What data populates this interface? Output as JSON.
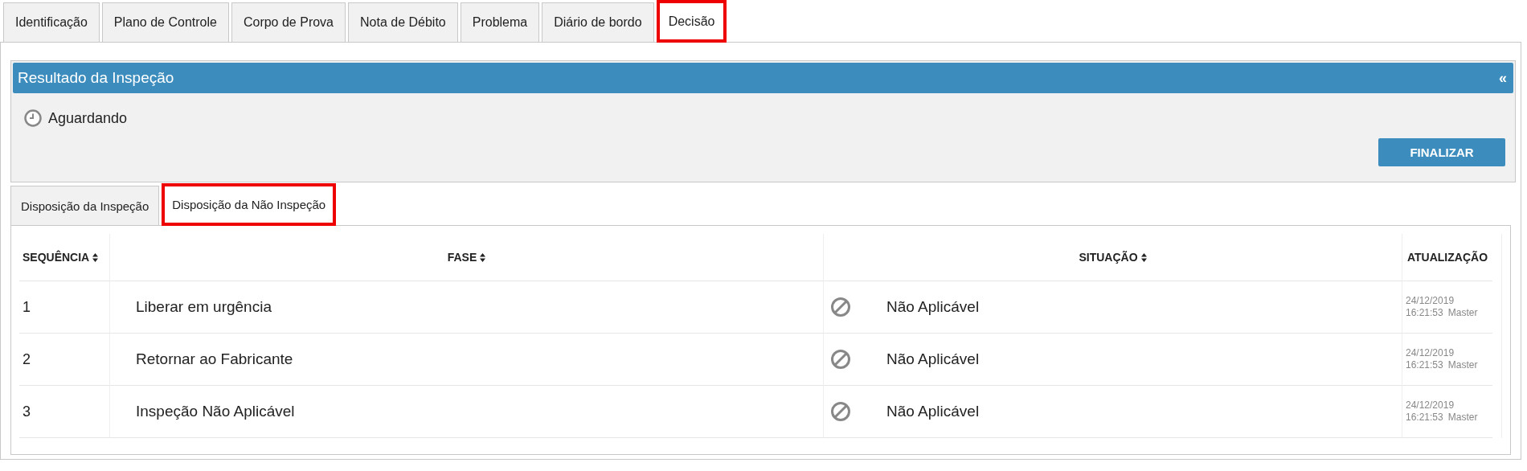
{
  "tabs": [
    {
      "label": "Identificação",
      "selected": false,
      "highlighted": false
    },
    {
      "label": "Plano de Controle",
      "selected": false,
      "highlighted": false
    },
    {
      "label": "Corpo de Prova",
      "selected": false,
      "highlighted": false
    },
    {
      "label": "Nota de Débito",
      "selected": false,
      "highlighted": false
    },
    {
      "label": "Problema",
      "selected": false,
      "highlighted": false
    },
    {
      "label": "Diário de bordo",
      "selected": false,
      "highlighted": false
    },
    {
      "label": "Decisão",
      "selected": true,
      "highlighted": true
    }
  ],
  "result_panel": {
    "title": "Resultado da Inspeção",
    "collapse": "«",
    "status": "Aguardando",
    "button": "FINALIZAR"
  },
  "sub_tabs": [
    {
      "label": "Disposição da Inspeção",
      "selected": false,
      "highlighted": false
    },
    {
      "label": "Disposição da Não Inspeção",
      "selected": true,
      "highlighted": true
    }
  ],
  "table": {
    "columns": [
      {
        "label": "SEQUÊNCIA",
        "sortable": true
      },
      {
        "label": "FASE",
        "sortable": true
      },
      {
        "label": "SITUAÇÃO",
        "sortable": true
      },
      {
        "label": "ATUALIZAÇÃO",
        "sortable": false
      }
    ],
    "rows": [
      {
        "sequence": "1",
        "phase": "Liberar em urgência",
        "status": "Não Aplicável",
        "date": "24/12/2019",
        "time": "16:21:53",
        "user": "Master"
      },
      {
        "sequence": "2",
        "phase": "Retornar ao Fabricante",
        "status": "Não Aplicável",
        "date": "24/12/2019",
        "time": "16:21:53",
        "user": "Master"
      },
      {
        "sequence": "3",
        "phase": "Inspeção Não Aplicável",
        "status": "Não Aplicável",
        "date": "24/12/2019",
        "time": "16:21:53",
        "user": "Master"
      }
    ]
  }
}
